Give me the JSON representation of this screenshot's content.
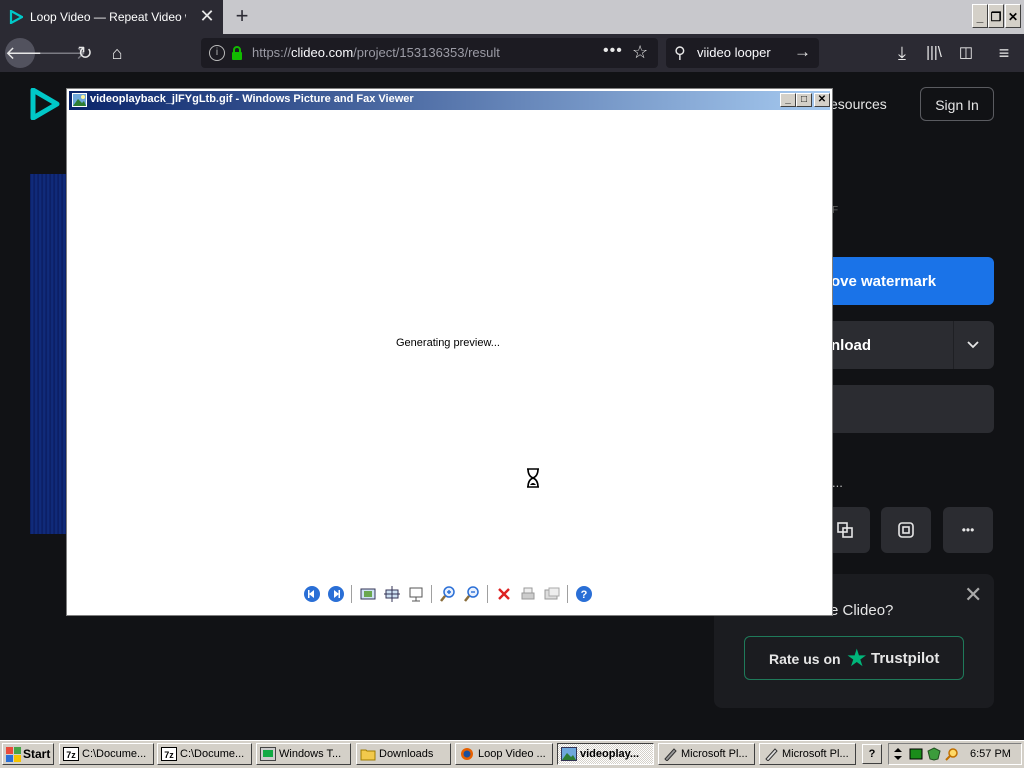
{
  "browser": {
    "tab_title": "Loop Video — Repeat Video with C",
    "url_scheme": "https://",
    "url_host": "clideo.com",
    "url_path": "/project/153136353/result",
    "search_text": "viideo looper"
  },
  "page": {
    "nav_resources": "esources",
    "sign_in": "Sign In",
    "format_letter": "F",
    "remove_watermark": "ove watermark",
    "download": "nload",
    "edit_more": "...",
    "more_label": "•••",
    "rate_question": "e Clideo?",
    "rate_us_on": "Rate us on",
    "trustpilot": "Trustpilot"
  },
  "viewer": {
    "title": "videoplayback_jlFYgLtb.gif - Windows Picture and Fax Viewer",
    "status": "Generating preview..."
  },
  "taskbar": {
    "start": "Start",
    "tasks": [
      {
        "label": "C:\\Docume..."
      },
      {
        "label": "C:\\Docume..."
      },
      {
        "label": "Windows T..."
      },
      {
        "label": "Downloads"
      },
      {
        "label": "Loop Video ..."
      },
      {
        "label": "videoplay..."
      },
      {
        "label": "Microsoft Pl..."
      },
      {
        "label": "Microsoft Pl..."
      }
    ],
    "help": "?",
    "clock": "6:57 PM"
  },
  "colors": {
    "accent_blue": "#1a73e8",
    "trustpilot_green": "#00b67a",
    "clideo_teal": "#00c8c8"
  }
}
